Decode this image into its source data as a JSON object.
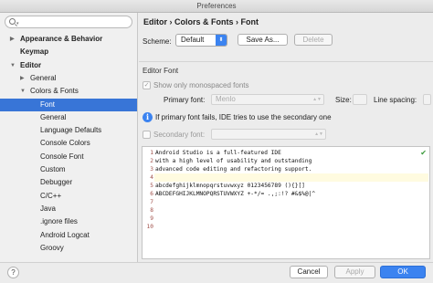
{
  "window": {
    "title": "Preferences"
  },
  "search": {
    "placeholder": ""
  },
  "sidebar": {
    "items": [
      {
        "label": "Appearance & Behavior",
        "bold": true,
        "arrow": "▶"
      },
      {
        "label": "Keymap",
        "bold": true,
        "arrow": ""
      },
      {
        "label": "Editor",
        "bold": true,
        "arrow": "▼"
      },
      {
        "label": "General",
        "bold": false,
        "arrow": "▶"
      },
      {
        "label": "Colors & Fonts",
        "bold": false,
        "arrow": "▼"
      },
      {
        "label": "Font",
        "bold": false,
        "arrow": "",
        "selected": true
      },
      {
        "label": "General",
        "bold": false,
        "arrow": ""
      },
      {
        "label": "Language Defaults",
        "bold": false,
        "arrow": ""
      },
      {
        "label": "Console Colors",
        "bold": false,
        "arrow": ""
      },
      {
        "label": "Console Font",
        "bold": false,
        "arrow": ""
      },
      {
        "label": "Custom",
        "bold": false,
        "arrow": ""
      },
      {
        "label": "Debugger",
        "bold": false,
        "arrow": ""
      },
      {
        "label": "C/C++",
        "bold": false,
        "arrow": ""
      },
      {
        "label": "Java",
        "bold": false,
        "arrow": ""
      },
      {
        "label": ".ignore files",
        "bold": false,
        "arrow": ""
      },
      {
        "label": "Android Logcat",
        "bold": false,
        "arrow": ""
      },
      {
        "label": "Groovy",
        "bold": false,
        "arrow": ""
      }
    ]
  },
  "main": {
    "breadcrumb": "Editor › Colors & Fonts › Font",
    "scheme_label": "Scheme:",
    "scheme_value": "Default",
    "save_as_label": "Save As...",
    "delete_label": "Delete",
    "section_title": "Editor Font",
    "mono_label": "Show only monospaced fonts",
    "primary_font_label": "Primary font:",
    "primary_font_value": "Menlo",
    "size_label": "Size:",
    "line_spacing_label": "Line spacing:",
    "info_text": "If primary font fails, IDE tries to use the secondary one",
    "secondary_font_label": "Secondary font:"
  },
  "editor": {
    "lines": [
      {
        "num": "1",
        "text": "Android Studio is a full-featured IDE"
      },
      {
        "num": "2",
        "text": "with a high level of usability and outstanding"
      },
      {
        "num": "3",
        "text": "advanced code editing and refactoring support."
      },
      {
        "num": "4",
        "text": ""
      },
      {
        "num": "5",
        "text": "abcdefghijklmnopqrstuvwxyz 0123456789 (){}[]"
      },
      {
        "num": "6",
        "text": "ABCDEFGHIJKLMNOPQRSTUVWXYZ +-*/= .,;:!? #&$%@|^"
      },
      {
        "num": "7",
        "text": ""
      },
      {
        "num": "8",
        "text": ""
      },
      {
        "num": "9",
        "text": ""
      },
      {
        "num": "10",
        "text": ""
      }
    ]
  },
  "footer": {
    "help_label": "?",
    "cancel_label": "Cancel",
    "apply_label": "Apply",
    "ok_label": "OK"
  },
  "colors": {
    "accent": "#3b83f0",
    "selection": "#3875d7",
    "line_number": "#a0504a",
    "caret_row": "#fffbe0"
  }
}
